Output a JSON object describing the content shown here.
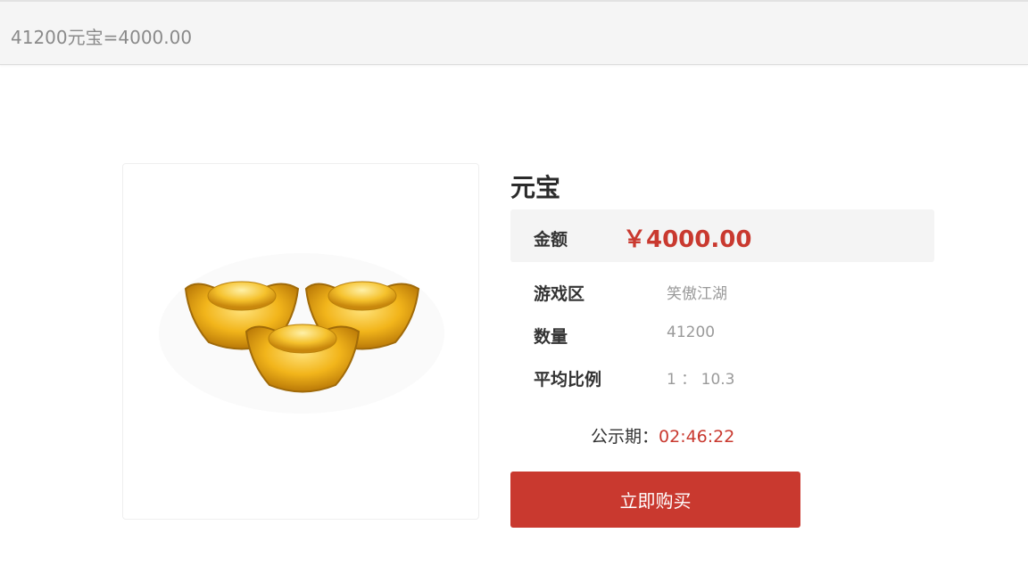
{
  "header": {
    "title": "41200元宝=4000.00"
  },
  "product": {
    "image_icon": "gold-ingots-icon",
    "name": "元宝",
    "price_label": "金额",
    "price_value": "￥4000.00",
    "details": [
      {
        "key": "游戏区",
        "value": "笑傲江湖"
      },
      {
        "key": "数量",
        "value": "41200"
      },
      {
        "key": "平均比例",
        "value": "1 ：  10.3"
      }
    ],
    "period_label": "公示期：",
    "period_time": "02:46:22",
    "buy_label": "立即购买"
  },
  "colors": {
    "accent": "#c9392f",
    "price_bg": "#f4f4f4",
    "header_bg": "#f5f5f5"
  }
}
